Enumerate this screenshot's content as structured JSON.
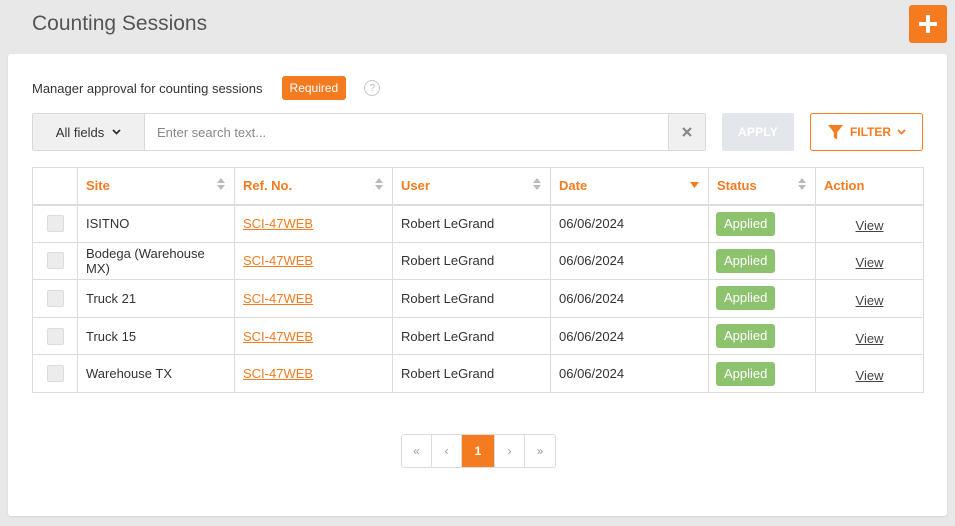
{
  "page": {
    "title": "Counting Sessions"
  },
  "approval": {
    "label": "Manager approval for counting sessions",
    "badge": "Required",
    "help": "?"
  },
  "search": {
    "field_select": "All fields",
    "placeholder": "Enter search text...",
    "value": "",
    "apply": "APPLY",
    "filter": "FILTER"
  },
  "table": {
    "columns": [
      "",
      "Site",
      "Ref. No.",
      "User",
      "Date",
      "Status",
      "Action"
    ],
    "rows": [
      {
        "site": "ISITNO",
        "ref": "SCI-47WEB",
        "user": "Robert LeGrand",
        "date": "06/06/2024",
        "status": "Applied",
        "action": "View"
      },
      {
        "site": "Bodega (Warehouse MX)",
        "ref": "SCI-47WEB",
        "user": "Robert LeGrand",
        "date": "06/06/2024",
        "status": "Applied",
        "action": "View"
      },
      {
        "site": "Truck 21",
        "ref": "SCI-47WEB",
        "user": "Robert LeGrand",
        "date": "06/06/2024",
        "status": "Applied",
        "action": "View"
      },
      {
        "site": "Truck 15",
        "ref": "SCI-47WEB",
        "user": "Robert LeGrand",
        "date": "06/06/2024",
        "status": "Applied",
        "action": "View"
      },
      {
        "site": "Warehouse TX",
        "ref": "SCI-47WEB",
        "user": "Robert LeGrand",
        "date": "06/06/2024",
        "status": "Applied",
        "action": "View"
      }
    ]
  },
  "pagination": {
    "first": "«",
    "prev": "‹",
    "current": "1",
    "next": "›",
    "last": "»"
  },
  "colors": {
    "accent": "#f47b20",
    "status_applied": "#8dc26f"
  },
  "icons": {
    "add": "plus-icon",
    "help": "question-icon",
    "clear": "close-icon",
    "filter": "funnel-icon",
    "dropdown": "chevron-down-icon",
    "sort": "sort-icon"
  }
}
